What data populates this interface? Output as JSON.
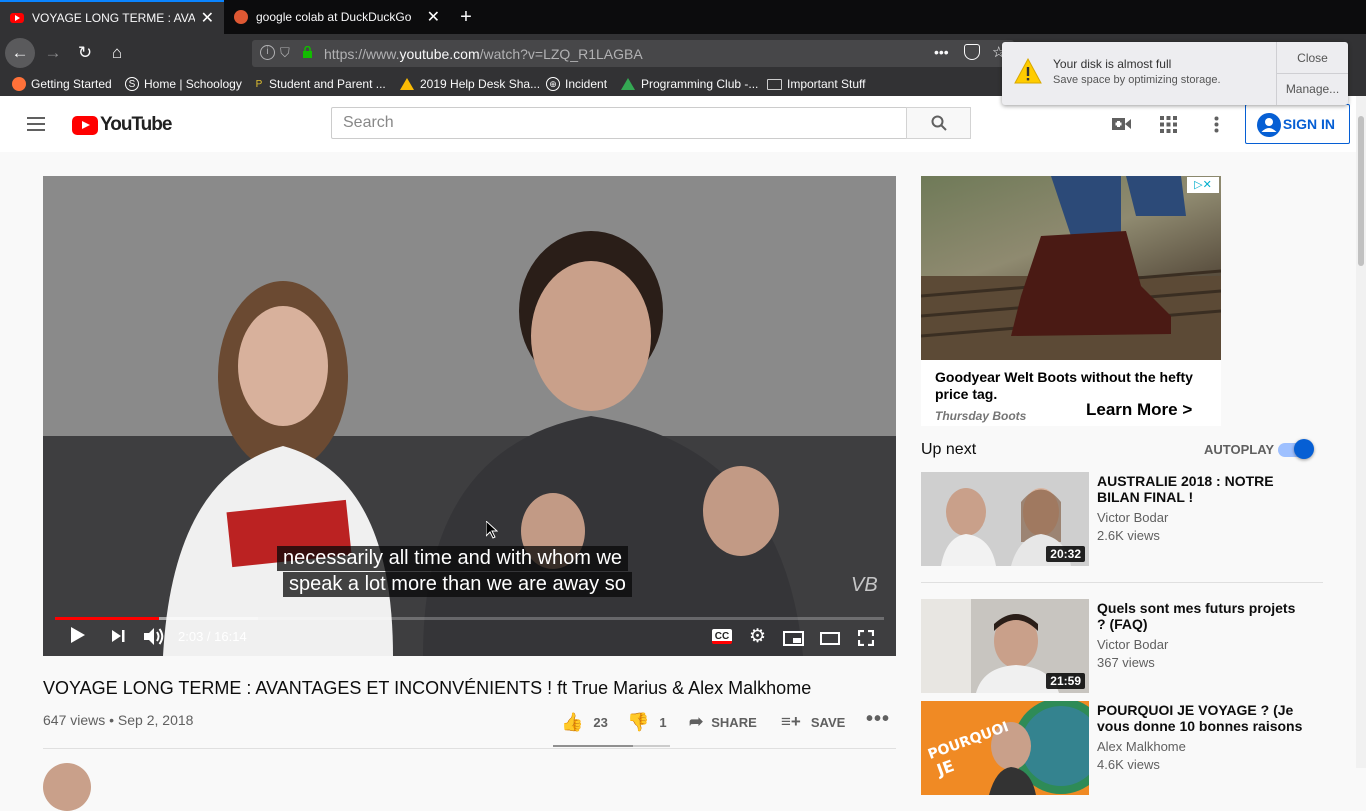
{
  "browser": {
    "tabs": [
      {
        "title": "VOYAGE LONG TERME : AVANTAGES",
        "close": "✕"
      },
      {
        "title": "google colab at DuckDuckGo",
        "close": "✕"
      }
    ],
    "new_tab": "+",
    "url_prefix": "https://www.",
    "url_domain": "youtube.com",
    "url_path": "/watch?v=LZQ_R1LAGBA",
    "url_more": "•••",
    "bookmarks": [
      {
        "label": "Getting Started",
        "icon": "firefox-icon"
      },
      {
        "label": "Home | Schoology",
        "icon": "schoology-icon"
      },
      {
        "label": "Student and Parent ...",
        "icon": "bookmark-icon"
      },
      {
        "label": "2019 Help Desk Sha...",
        "icon": "drive-icon"
      },
      {
        "label": "Incident",
        "icon": "globe-icon"
      },
      {
        "label": "Programming Club -...",
        "icon": "drive-icon"
      },
      {
        "label": "Important Stuff",
        "icon": "folder-icon"
      }
    ]
  },
  "notification": {
    "title": "Your disk is almost full",
    "subtitle": "Save space by optimizing storage.",
    "close": "Close",
    "manage": "Manage..."
  },
  "youtube": {
    "logo": "YouTube",
    "search_placeholder": "Search",
    "sign_in": "SIGN IN"
  },
  "player": {
    "caption_line1": "necessarily all time and with whom we",
    "caption_line2": "speak a lot more than we are away so",
    "time": "2:03 / 16:14",
    "watermark": "VB",
    "progress_played": 0.1255,
    "progress_loaded": 0.245
  },
  "video": {
    "title": "VOYAGE LONG TERME : AVANTAGES ET INCONVÉNIENTS ! ft True Marius & Alex Malkhome",
    "meta": "647 views • Sep 2, 2018",
    "likes": "23",
    "dislikes": "1",
    "share": "SHARE",
    "save": "SAVE"
  },
  "ad": {
    "headline": "Goodyear Welt Boots without the hefty price tag.",
    "advertiser": "Thursday Boots",
    "cta": "Learn More >"
  },
  "upnext": {
    "label": "Up next",
    "autoplay": "AUTOPLAY",
    "autoplay_on": true,
    "videos": [
      {
        "title": "AUSTRALIE 2018 : NOTRE BILAN FINAL !",
        "channel": "Victor Bodar",
        "views": "2.6K views",
        "duration": "20:32"
      },
      {
        "title": "Quels sont mes futurs projets ? (FAQ)",
        "channel": "Victor Bodar",
        "views": "367 views",
        "duration": "21:59"
      },
      {
        "title": "POURQUOI JE VOYAGE ? (Je vous donne 10 bonnes raisons",
        "channel": "Alex Malkhome",
        "views": "4.6K views",
        "duration": ""
      }
    ]
  },
  "colors": {
    "accent": "#ff0000",
    "link": "#065fd4",
    "chrome": "#323234"
  }
}
